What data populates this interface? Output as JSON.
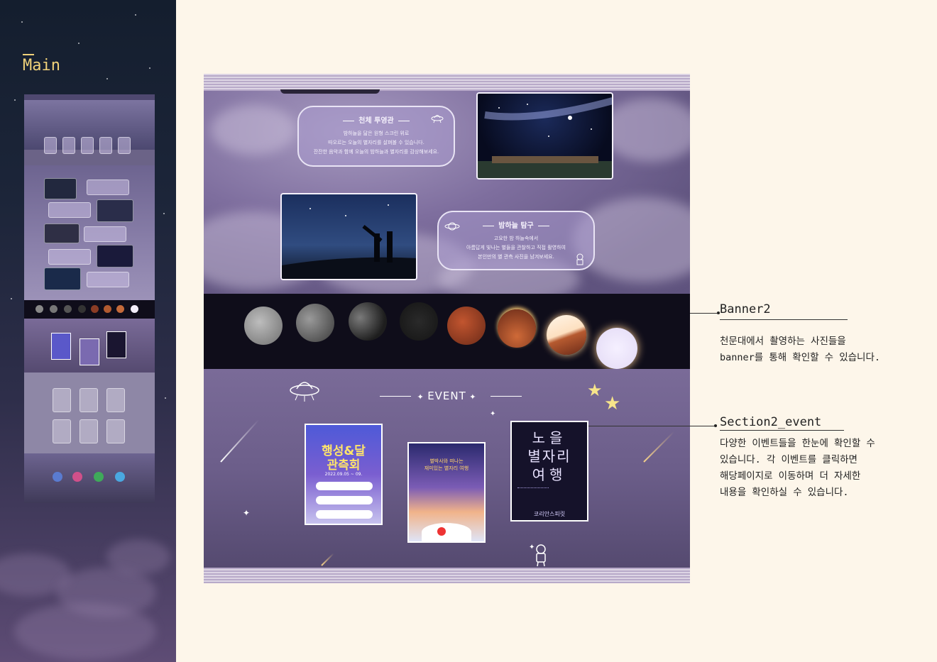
{
  "sidebar": {
    "title": "Main"
  },
  "mockup": {
    "card1": {
      "title": "천체 투영관",
      "text": "밤하늘을 닮은 원형 스크린 위로\n따오르는 오늘의 별자리를 살펴볼 수 있습니다.\n잔잔한 음악과 함께 오늘의 밤하늘과 별자리를 감상해보세요."
    },
    "card2": {
      "title": "밤하늘 탐구",
      "text": "고요한 밤 하늘속에서\n아름답게 빛나는 별들을 관찰하고 직접 촬영하여\n본인만의 별 관측 사진을 남겨보세요."
    },
    "event_title": "EVENT",
    "poster1": {
      "line1": "행성&달",
      "line2": "관측회",
      "date": "2022.09.05 ~ 09."
    },
    "poster2": {
      "line1": "별박사와 떠나는",
      "line2": "재미있는 별자리 여행"
    },
    "poster3": {
      "line1": "노을",
      "line2": "별자리",
      "line3": "여행",
      "footer": "코리안스피릿"
    }
  },
  "annotations": [
    {
      "title": "Banner2",
      "desc": "천문대에서 촬영하는 사진들을\nbanner를 통해 확인할 수 있습니다."
    },
    {
      "title": "Section2_event",
      "desc": "다양한 이벤트들을 한눈에 확인할 수\n있습니다. 각 이벤트를 클릭하면\n해당페이지로 이동하며 더 자세한\n내용을 확인하실 수 있습니다."
    }
  ],
  "colors": {
    "accent": "#f1d27a",
    "background": "#fdf6ea",
    "sidebar": "#1c2539",
    "event_bg": "#6c5e8a"
  },
  "icons": [
    "ufo-icon",
    "star-icon",
    "astronaut-icon",
    "planet-icon",
    "shooting-star-icon"
  ]
}
